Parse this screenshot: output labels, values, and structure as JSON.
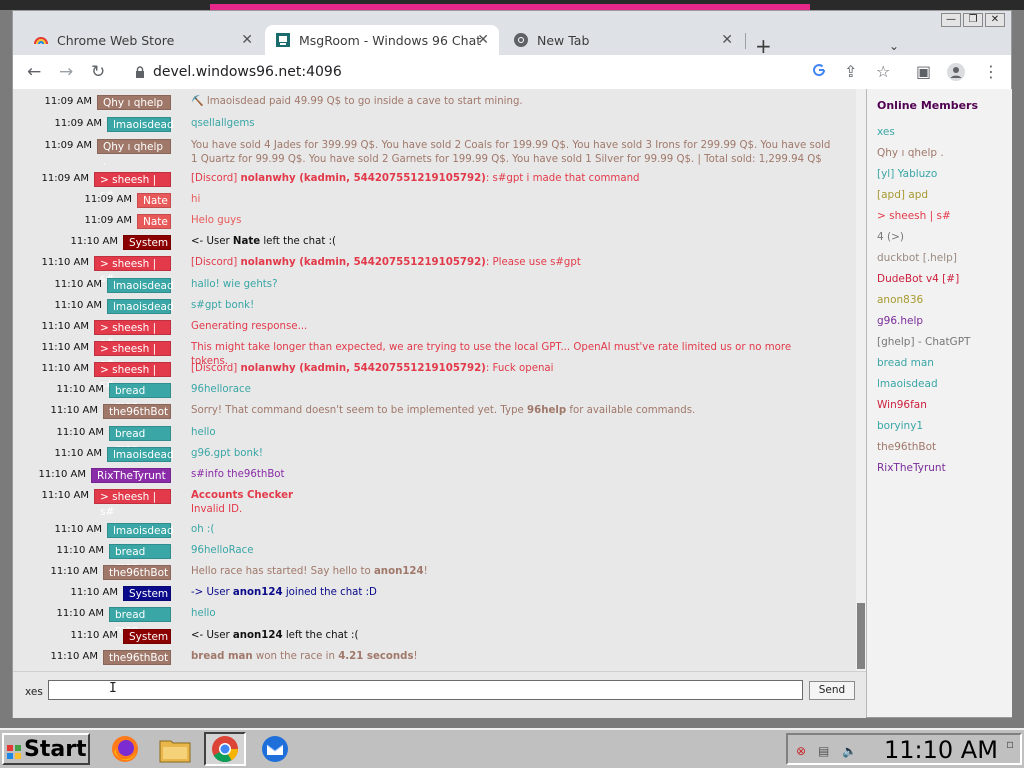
{
  "browser": {
    "tabs": [
      {
        "title": "Chrome Web Store",
        "close": "✕"
      },
      {
        "title": "MsgRoom - Windows 96 Chat",
        "close": "✕"
      },
      {
        "title": "New Tab",
        "close": "✕"
      }
    ],
    "new_tab": "+",
    "tab_menu": "⌄",
    "url": "devel.windows96.net:4096",
    "window_controls": {
      "minimize": "—",
      "maximize": "❐",
      "close": "✕"
    }
  },
  "sidebar": {
    "title": "Online Members",
    "members": [
      {
        "name": "xes",
        "color": "#3aa6a6"
      },
      {
        "name": "Qhy ı qhelp .",
        "color": "#a0786a"
      },
      {
        "name": "[yl] Yabluzo",
        "color": "#3aa6a6"
      },
      {
        "name": "[apd] apd",
        "color": "#a89a30"
      },
      {
        "name": "> sheesh | s#",
        "color": "#e23a4a"
      },
      {
        "name": "4 (>)",
        "color": "#777777"
      },
      {
        "name": "duckbot [.help]",
        "color": "#9a8a80"
      },
      {
        "name": "DudeBot v4 [#]",
        "color": "#cc1f3c"
      },
      {
        "name": "anon836",
        "color": "#a89a30"
      },
      {
        "name": "g96.help",
        "color": "#7a2d9a"
      },
      {
        "name": "[ghelp] - ChatGPT",
        "color": "#777777"
      },
      {
        "name": "bread man",
        "color": "#3aa6a6"
      },
      {
        "name": "lmaoisdead",
        "color": "#3aa6a6"
      },
      {
        "name": "Win96fan",
        "color": "#cc1f3c"
      },
      {
        "name": "boryiny1",
        "color": "#3aa6a6"
      },
      {
        "name": "the96thBot",
        "color": "#a0786a"
      },
      {
        "name": "RixTheTyrunt",
        "color": "#7a2d9a"
      }
    ]
  },
  "messages": [
    {
      "time": "11:09 AM",
      "user": "Qhy ı qhelp .",
      "user_color": "#a0786a",
      "segments": [
        {
          "t": "⛏️ lmaoisdead paid 49.99 Q$ to go inside a cave to start mining.",
          "b": false
        }
      ],
      "text_color": "#a0786a"
    },
    {
      "time": "11:09 AM",
      "user": "lmaoisdead",
      "user_color": "#3aa6a6",
      "segments": [
        {
          "t": "qsellallgems",
          "b": false
        }
      ],
      "text_color": "#3aa6a6"
    },
    {
      "time": "11:09 AM",
      "user": "Qhy ı qhelp .",
      "user_color": "#a0786a",
      "segments": [
        {
          "t": "You have sold 4 Jades for 399.99 Q$. You have sold 2 Coals for 199.99 Q$. You have sold 3 Irons for 299.99 Q$. You have sold 1 Quartz for 99.99 Q$. You have sold 2 Garnets for 199.99 Q$. You have sold 1 Silver for 99.99 Q$. | Total sold: 1,299.94 Q$",
          "b": false
        }
      ],
      "text_color": "#a0786a"
    },
    {
      "time": "11:09 AM",
      "user": "> sheesh | s#",
      "user_color": "#e23a4a",
      "segments": [
        {
          "t": "[Discord] ",
          "b": false
        },
        {
          "t": "nolanwhy (kadmin, 544207551219105792)",
          "b": true
        },
        {
          "t": ": s#gpt i made that command",
          "b": false
        }
      ],
      "text_color": "#e23a4a"
    },
    {
      "time": "11:09 AM",
      "user": "Nate",
      "user_color": "#e85a5a",
      "segments": [
        {
          "t": "hi",
          "b": false
        }
      ],
      "text_color": "#e85a5a"
    },
    {
      "time": "11:09 AM",
      "user": "Nate",
      "user_color": "#e85a5a",
      "segments": [
        {
          "t": "Helo guys",
          "b": false
        }
      ],
      "text_color": "#e85a5a"
    },
    {
      "time": "11:10 AM",
      "user": "System",
      "user_color": "#8b0000",
      "segments": [
        {
          "t": "<- User ",
          "b": false
        },
        {
          "t": "Nate",
          "b": true
        },
        {
          "t": " left the chat :(",
          "b": false
        }
      ],
      "text_color": "#111111"
    },
    {
      "time": "11:10 AM",
      "user": "> sheesh | s#",
      "user_color": "#e23a4a",
      "segments": [
        {
          "t": "[Discord] ",
          "b": false
        },
        {
          "t": "nolanwhy (kadmin, 544207551219105792)",
          "b": true
        },
        {
          "t": ": Please use s#gpt",
          "b": false
        }
      ],
      "text_color": "#e23a4a"
    },
    {
      "time": "11:10 AM",
      "user": "lmaoisdead",
      "user_color": "#3aa6a6",
      "segments": [
        {
          "t": "hallo! wie gehts?",
          "b": false
        }
      ],
      "text_color": "#3aa6a6"
    },
    {
      "time": "11:10 AM",
      "user": "lmaoisdead",
      "user_color": "#3aa6a6",
      "segments": [
        {
          "t": "s#gpt bonk!",
          "b": false
        }
      ],
      "text_color": "#3aa6a6"
    },
    {
      "time": "11:10 AM",
      "user": "> sheesh | s#",
      "user_color": "#e23a4a",
      "segments": [
        {
          "t": "Generating response...",
          "b": false
        }
      ],
      "text_color": "#e23a4a"
    },
    {
      "time": "11:10 AM",
      "user": "> sheesh | s#",
      "user_color": "#e23a4a",
      "segments": [
        {
          "t": "This might take longer than expected, we are trying to use the local GPT... OpenAI must've rate limited us or no more tokens.",
          "b": false
        }
      ],
      "text_color": "#e23a4a"
    },
    {
      "time": "11:10 AM",
      "user": "> sheesh | s#",
      "user_color": "#e23a4a",
      "segments": [
        {
          "t": "[Discord] ",
          "b": false
        },
        {
          "t": "nolanwhy (kadmin, 544207551219105792)",
          "b": true
        },
        {
          "t": ": Fuck openai",
          "b": false
        }
      ],
      "text_color": "#e23a4a"
    },
    {
      "time": "11:10 AM",
      "user": "bread man",
      "user_color": "#3aa6a6",
      "segments": [
        {
          "t": "96hellorace",
          "b": false
        }
      ],
      "text_color": "#3aa6a6"
    },
    {
      "time": "11:10 AM",
      "user": "the96thBot",
      "user_color": "#a0786a",
      "segments": [
        {
          "t": "Sorry! That command doesn't seem to be implemented yet. Type ",
          "b": false
        },
        {
          "t": "96help",
          "b": true
        },
        {
          "t": " for available commands.",
          "b": false
        }
      ],
      "text_color": "#a0786a"
    },
    {
      "time": "11:10 AM",
      "user": "bread man",
      "user_color": "#3aa6a6",
      "segments": [
        {
          "t": "hello",
          "b": false
        }
      ],
      "text_color": "#3aa6a6"
    },
    {
      "time": "11:10 AM",
      "user": "lmaoisdead",
      "user_color": "#3aa6a6",
      "segments": [
        {
          "t": "g96.gpt bonk!",
          "b": false
        }
      ],
      "text_color": "#3aa6a6"
    },
    {
      "time": "11:10 AM",
      "user": "RixTheTyrunt",
      "user_color": "#8a2ca8",
      "segments": [
        {
          "t": "s#info the96thBot",
          "b": false
        }
      ],
      "text_color": "#8a2ca8"
    },
    {
      "time": "11:10 AM",
      "user": "> sheesh | s#",
      "user_color": "#e23a4a",
      "segments": [
        {
          "t": "Accounts Checker",
          "b": true
        }
      ],
      "extra": "Invalid ID.",
      "text_color": "#e23a4a"
    },
    {
      "time": "11:10 AM",
      "user": "lmaoisdead",
      "user_color": "#3aa6a6",
      "segments": [
        {
          "t": "oh :(",
          "b": false
        }
      ],
      "text_color": "#3aa6a6"
    },
    {
      "time": "11:10 AM",
      "user": "bread man",
      "user_color": "#3aa6a6",
      "segments": [
        {
          "t": "96helloRace",
          "b": false
        }
      ],
      "text_color": "#3aa6a6"
    },
    {
      "time": "11:10 AM",
      "user": "the96thBot",
      "user_color": "#a0786a",
      "segments": [
        {
          "t": "Hello race has started! Say hello to ",
          "b": false
        },
        {
          "t": "anon124",
          "b": true
        },
        {
          "t": "!",
          "b": false
        }
      ],
      "text_color": "#a0786a"
    },
    {
      "time": "11:10 AM",
      "user": "System",
      "user_color": "#0a0a8a",
      "segments": [
        {
          "t": "-> User ",
          "b": false
        },
        {
          "t": "anon124",
          "b": true
        },
        {
          "t": " joined the chat :D",
          "b": false
        }
      ],
      "text_color": "#0a0a8a"
    },
    {
      "time": "11:10 AM",
      "user": "bread man",
      "user_color": "#3aa6a6",
      "segments": [
        {
          "t": "hello",
          "b": false
        }
      ],
      "text_color": "#3aa6a6"
    },
    {
      "time": "11:10 AM",
      "user": "System",
      "user_color": "#8b0000",
      "segments": [
        {
          "t": "<- User ",
          "b": false
        },
        {
          "t": "anon124",
          "b": true
        },
        {
          "t": " left the chat :(",
          "b": false
        }
      ],
      "text_color": "#111111"
    },
    {
      "time": "11:10 AM",
      "user": "the96thBot",
      "user_color": "#a0786a",
      "segments": [
        {
          "t": "bread man",
          "b": true
        },
        {
          "t": " won the race in ",
          "b": false
        },
        {
          "t": "4.21 seconds",
          "b": true
        },
        {
          "t": "!",
          "b": false
        }
      ],
      "text_color": "#a0786a"
    }
  ],
  "input": {
    "username": "xes",
    "value": "",
    "send_label": "Send"
  },
  "taskbar": {
    "start_label": "Start",
    "apps": [
      "firefox-icon",
      "file-manager-icon",
      "chrome-icon",
      "thunderbird-icon"
    ],
    "clock": "11:10 AM",
    "tray_icons": [
      "network-icon",
      "display-icon",
      "volume-icon"
    ]
  },
  "colors": {
    "accent_tab": "#ffffff",
    "pink_strip": "#e8278a",
    "sidebar_title": "#500050"
  }
}
